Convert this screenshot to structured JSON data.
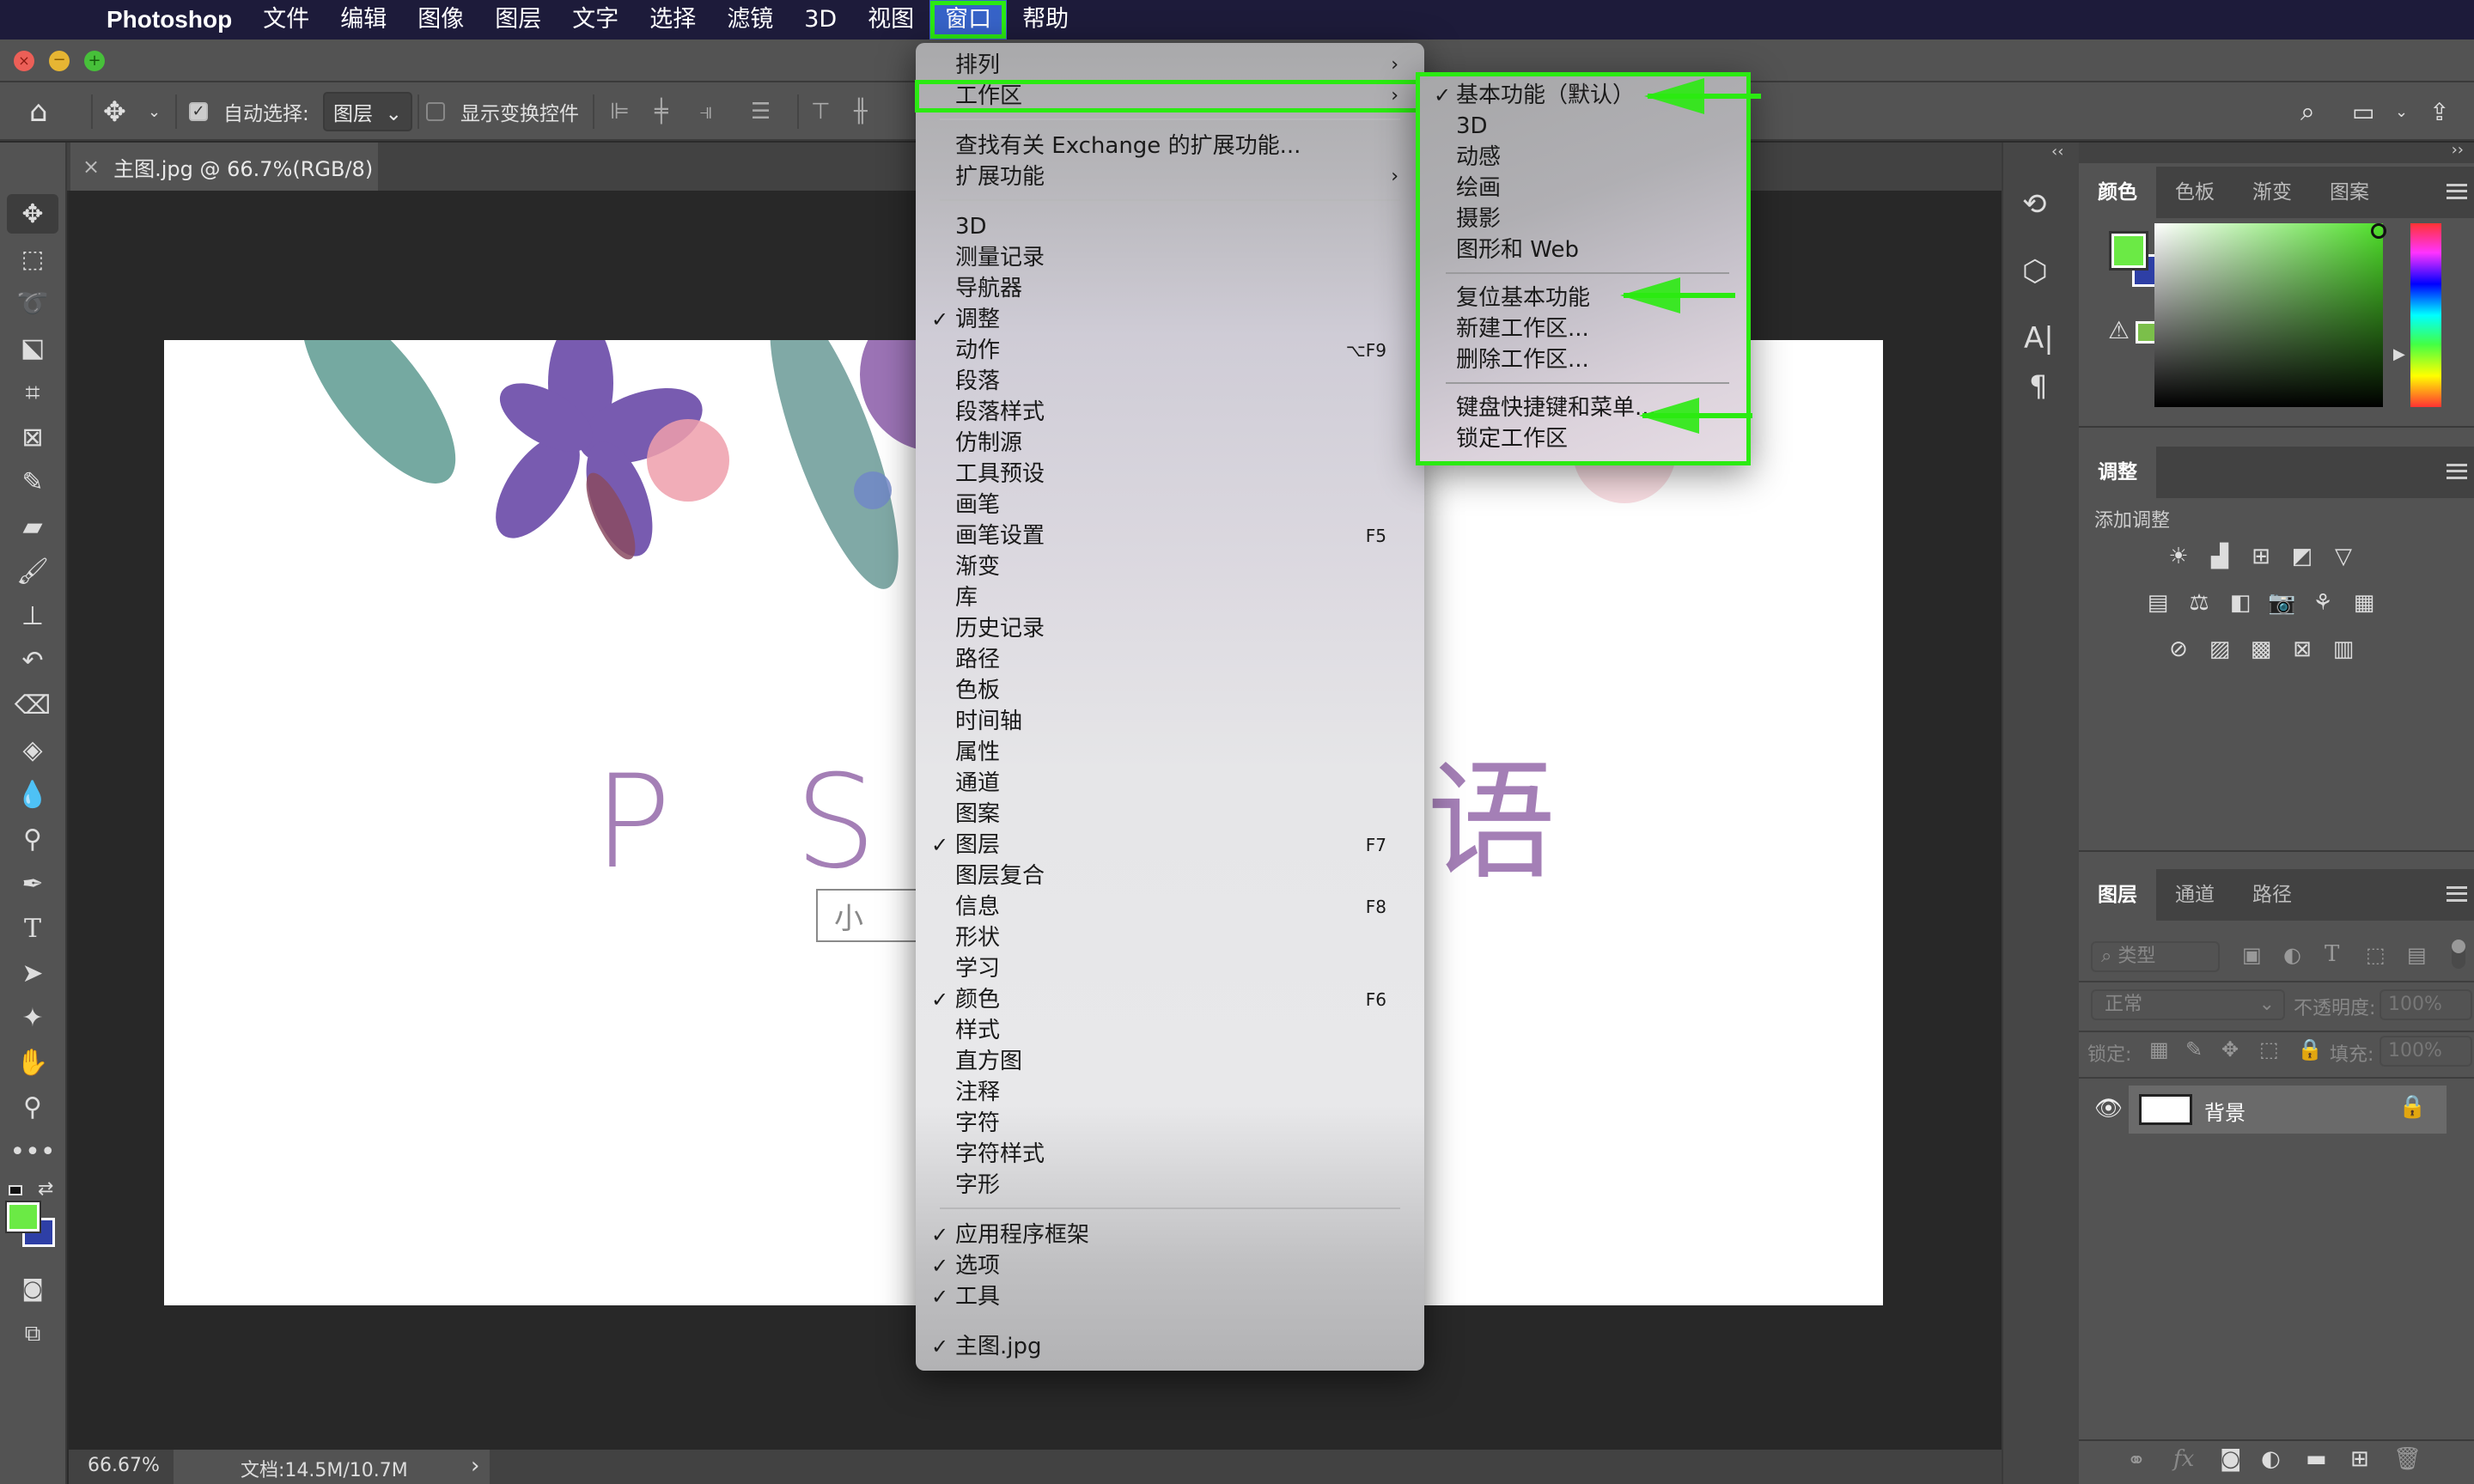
{
  "menubar": {
    "app_name": "Photoshop",
    "items": [
      "文件",
      "编辑",
      "图像",
      "图层",
      "文字",
      "选择",
      "滤镜",
      "3D",
      "视图",
      "窗口",
      "帮助"
    ],
    "active_item": "窗口"
  },
  "options_bar": {
    "auto_select_label": "自动选择:",
    "auto_select_checked": true,
    "auto_select_value": "图层",
    "show_transform_label": "显示变换控件",
    "show_transform_checked": false
  },
  "document_tab": {
    "close": "×",
    "title": "主图.jpg @ 66.7%(RGB/8)"
  },
  "canvas": {
    "headline": "P S 自 … 语",
    "headline_left": "P S 自",
    "headline_right": "语",
    "subtitle_box": "小 白"
  },
  "status_bar": {
    "zoom": "66.67%",
    "doc_info": "文档:14.5M/10.7M",
    "arrow": "›"
  },
  "window_menu": {
    "items": [
      {
        "label": "排列",
        "submenu": true
      },
      {
        "label": "工作区",
        "submenu": true,
        "highlighted": true
      },
      {
        "sep": true
      },
      {
        "label": "查找有关 Exchange 的扩展功能..."
      },
      {
        "label": "扩展功能",
        "submenu": true
      },
      {
        "sep": true
      },
      {
        "label": "3D"
      },
      {
        "label": "测量记录"
      },
      {
        "label": "导航器"
      },
      {
        "label": "调整",
        "checked": true
      },
      {
        "label": "动作",
        "shortcut": "⌥F9"
      },
      {
        "label": "段落"
      },
      {
        "label": "段落样式"
      },
      {
        "label": "仿制源"
      },
      {
        "label": "工具预设"
      },
      {
        "label": "画笔"
      },
      {
        "label": "画笔设置",
        "shortcut": "F5"
      },
      {
        "label": "渐变"
      },
      {
        "label": "库"
      },
      {
        "label": "历史记录"
      },
      {
        "label": "路径"
      },
      {
        "label": "色板"
      },
      {
        "label": "时间轴"
      },
      {
        "label": "属性"
      },
      {
        "label": "通道"
      },
      {
        "label": "图案"
      },
      {
        "label": "图层",
        "checked": true,
        "shortcut": "F7"
      },
      {
        "label": "图层复合"
      },
      {
        "label": "信息",
        "shortcut": "F8"
      },
      {
        "label": "形状"
      },
      {
        "label": "学习"
      },
      {
        "label": "颜色",
        "checked": true,
        "shortcut": "F6"
      },
      {
        "label": "样式"
      },
      {
        "label": "直方图"
      },
      {
        "label": "注释"
      },
      {
        "label": "字符"
      },
      {
        "label": "字符样式"
      },
      {
        "label": "字形"
      },
      {
        "sep": true
      },
      {
        "label": "应用程序框架",
        "checked": true
      },
      {
        "label": "选项",
        "checked": true
      },
      {
        "label": "工具",
        "checked": true
      },
      {
        "sep": true
      },
      {
        "label": "主图.jpg",
        "checked": true
      }
    ]
  },
  "workspace_submenu": {
    "items": [
      {
        "label": "基本功能（默认）",
        "checked": true,
        "annotated": true
      },
      {
        "label": "3D"
      },
      {
        "label": "动感"
      },
      {
        "label": "绘画"
      },
      {
        "label": "摄影"
      },
      {
        "label": "图形和 Web"
      },
      {
        "sep": true
      },
      {
        "label": "复位基本功能",
        "annotated": true
      },
      {
        "label": "新建工作区..."
      },
      {
        "label": "删除工作区..."
      },
      {
        "sep": true
      },
      {
        "label": "键盘快捷键和菜单...",
        "annotated": true
      },
      {
        "label": "锁定工作区"
      }
    ]
  },
  "color_panel": {
    "tabs": [
      "颜色",
      "色板",
      "渐变",
      "图案"
    ],
    "active_tab": "颜色",
    "foreground": "#6bea45",
    "background": "#2e3fa6",
    "gamut_swatch": "#7bbf4a"
  },
  "adjustments_panel": {
    "tab": "调整",
    "heading": "添加调整",
    "rows": [
      [
        "brightness-contrast",
        "levels",
        "curves",
        "exposure",
        "vibrance"
      ],
      [
        "hue-saturation",
        "color-balance",
        "black-white",
        "photo-filter",
        "channel-mixer",
        "color-lookup"
      ],
      [
        "invert",
        "posterize",
        "threshold",
        "selective-color",
        "gradient-map"
      ]
    ]
  },
  "layers_panel": {
    "tabs": [
      "图层",
      "通道",
      "路径"
    ],
    "active_tab": "图层",
    "filter_label": "类型",
    "blend_mode": "正常",
    "opacity_label": "不透明度:",
    "opacity": "100%",
    "lock_label": "锁定:",
    "fill_label": "填充:",
    "fill": "100%",
    "layers": [
      {
        "name": "背景",
        "visible": true,
        "locked": true
      }
    ]
  },
  "colors": {
    "accent_green": "#2bea12",
    "menubar_bg": "#1d1b3a",
    "panel_bg": "#535353",
    "headline_purple": "#a47fb6"
  }
}
